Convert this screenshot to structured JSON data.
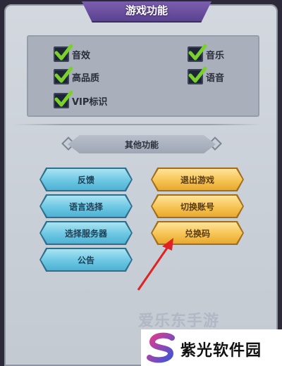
{
  "header": {
    "title": "游戏功能"
  },
  "settings": {
    "items": [
      {
        "label": "音效",
        "checked": true
      },
      {
        "label": "音乐",
        "checked": true
      },
      {
        "label": "高品质",
        "checked": true
      },
      {
        "label": "语音",
        "checked": true
      },
      {
        "label": "VIP标识",
        "checked": true
      }
    ]
  },
  "other": {
    "title": "其他功能",
    "left_buttons": [
      "反馈",
      "语言选择",
      "选择服务器",
      "公告"
    ],
    "right_buttons": [
      "退出游戏",
      "切换账号",
      "兑换码"
    ]
  },
  "watermark": {
    "top_text": "爱乐东手游",
    "logo_text": "紫光软件园"
  },
  "colors": {
    "title_banner": "#6a4f9f",
    "blue_button": "#6cc7e3",
    "gold_button": "#f6c453",
    "check_green": "#7ad12c",
    "arrow_red": "#e02222"
  }
}
